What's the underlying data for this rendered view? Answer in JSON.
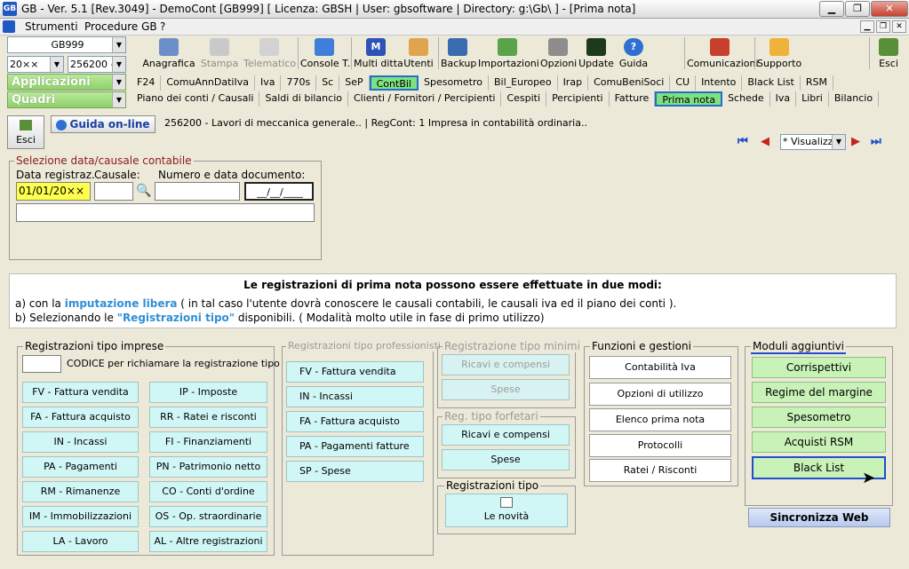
{
  "window": {
    "title": "GB - Ver. 5.1 [Rev.3049] - DemoCont [GB999]   [ Licenza: GBSH | User: gbsoftware | Directory: g:\\Gb\\ ] - [Prima nota]"
  },
  "menu": [
    "Strumenti",
    "Procedure GB",
    "?"
  ],
  "toolbar": {
    "company": "GB999",
    "year": "20××",
    "code": "256200 -",
    "applicazioni": "Applicazioni",
    "quadri": "Quadri",
    "buttons": [
      {
        "label": "Anagrafica"
      },
      {
        "label": "Stampa"
      },
      {
        "label": "Telematico"
      },
      {
        "label": "Console T."
      },
      {
        "label": "Multi ditta"
      },
      {
        "label": "Utenti"
      },
      {
        "label": "Backup"
      },
      {
        "label": "Importazioni"
      },
      {
        "label": "Opzioni"
      },
      {
        "label": "Update"
      },
      {
        "label": "Guida"
      },
      {
        "label": "Comunicazioni"
      },
      {
        "label": "Supporto"
      },
      {
        "label": "Esci"
      }
    ],
    "tabs_row1": [
      "F24",
      "ComuAnnDatiIva",
      "Iva",
      "770s",
      "Sc",
      "SeP",
      "ContBil",
      "Spesometro",
      "Bil_Europeo",
      "Irap",
      "ComuBeniSoci",
      "CU",
      "Intento",
      "Black List",
      "RSM"
    ],
    "tabs_row2": [
      "Piano dei conti / Causali",
      "Saldi di bilancio",
      "Clienti / Fornitori / Percipienti",
      "Cespiti",
      "Percipienti",
      "Fatture",
      "Prima nota",
      "Schede",
      "Iva",
      "Libri",
      "Bilancio"
    ]
  },
  "top": {
    "esci": "Esci",
    "guida": "Guida on-line",
    "info": "256200 - Lavori di meccanica generale.. | RegCont: 1 Impresa  in contabilità ordinaria..",
    "nav_select": "* Visualizz"
  },
  "selezione": {
    "title": "Selezione data/causale contabile",
    "data_label": "Data registraz.",
    "data_value": "01/01/20××",
    "causale_label": "Causale:",
    "numero_label": "Numero e data documento:",
    "date_mask": "__/__/____"
  },
  "info_box": {
    "heading": "Le registrazioni di prima nota possono essere effettuate in due modi:",
    "line_a_pre": "a) con la ",
    "line_a_hl": "imputazione libera",
    "line_a_post": " ( in tal caso l'utente dovrà conoscere le causali contabili, le causali iva ed il piano dei conti ).",
    "line_b_pre": "b) Selezionando le ",
    "line_b_hl": "\"Registrazioni tipo\"",
    "line_b_post": " disponibili. ( Modalità molto utile in fase di primo utilizzo)"
  },
  "imprese": {
    "title": "Registrazioni tipo imprese",
    "codice_label": "CODICE per richiamare la registrazione tipo",
    "left": [
      "FV - Fattura vendita",
      "FA - Fattura acquisto",
      "IN - Incassi",
      "PA - Pagamenti",
      "RM - Rimanenze",
      "IM - Immobilizzazioni",
      "LA - Lavoro"
    ],
    "right": [
      "IP - Imposte",
      "RR - Ratei e risconti",
      "FI - Finanziamenti",
      "PN - Patrimonio netto",
      "CO - Conti d'ordine",
      "OS - Op. straordinarie",
      "AL - Altre registrazioni"
    ]
  },
  "professionisti": {
    "title": "Registrazioni tipo professionisti",
    "items": [
      "FV - Fattura vendita",
      "IN - Incassi",
      "FA - Fattura acquisto",
      "PA - Pagamenti fatture",
      "SP - Spese"
    ]
  },
  "minimi": {
    "title": "Registrazione tipo minimi",
    "items": [
      "Ricavi e compensi",
      "Spese"
    ]
  },
  "forfetari": {
    "title": "Reg. tipo forfetari",
    "items": [
      "Ricavi e compensi",
      "Spese"
    ]
  },
  "tipo": {
    "title": "Registrazioni tipo",
    "novita": "Le novità"
  },
  "funzioni": {
    "title": "Funzioni e gestioni",
    "items": [
      "Contabilità Iva",
      "Opzioni di utilizzo",
      "Elenco prima nota",
      "Protocolli",
      "Ratei / Risconti"
    ]
  },
  "moduli": {
    "title": "Moduli aggiuntivi",
    "items": [
      "Corrispettivi",
      "Regime del margine",
      "Spesometro",
      "Acquisti RSM",
      "Black List"
    ],
    "sync": "Sincronizza Web"
  }
}
